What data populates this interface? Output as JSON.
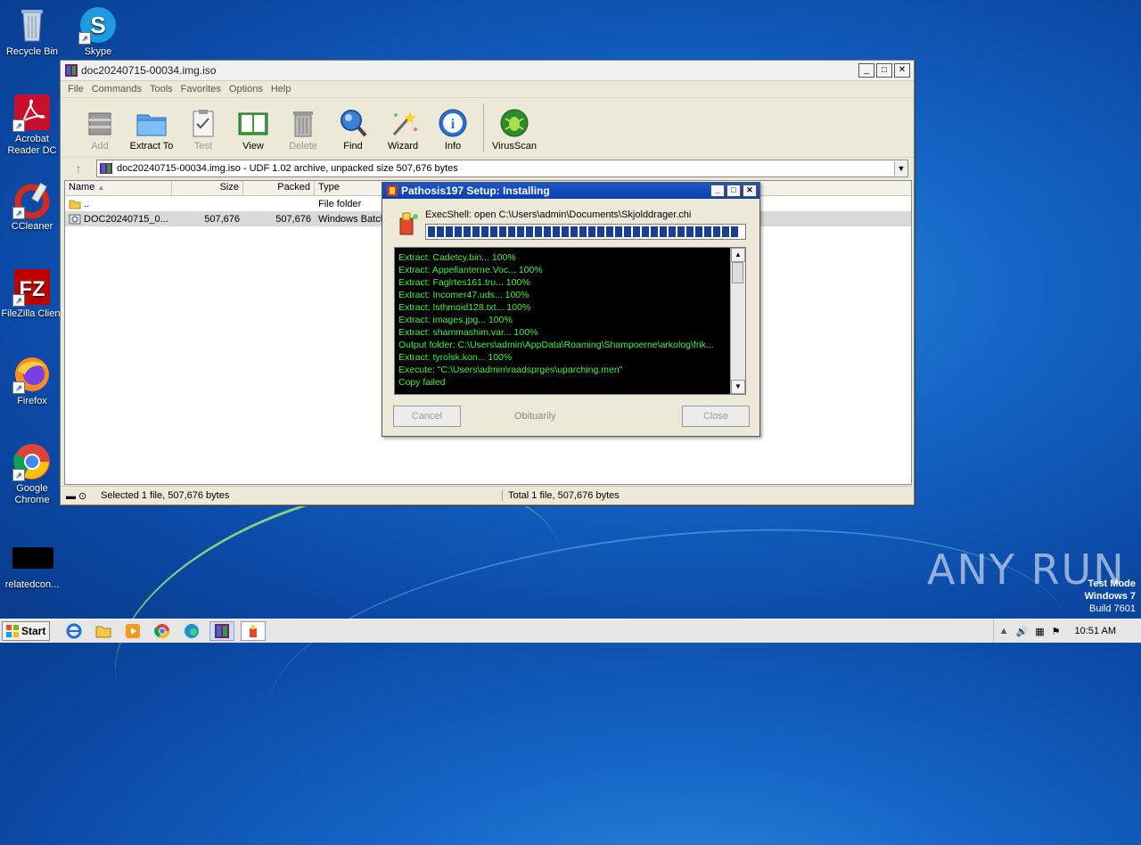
{
  "desktop": {
    "icons": [
      {
        "label": "Recycle Bin"
      },
      {
        "label": "Skype"
      },
      {
        "label": "Acrobat Reader DC"
      },
      {
        "label": "CCleaner"
      },
      {
        "label": "FileZilla Client"
      },
      {
        "label": "Firefox"
      },
      {
        "label": "Google Chrome"
      },
      {
        "label": "relatedcon..."
      }
    ]
  },
  "winrar": {
    "title": "doc20240715-00034.img.iso",
    "menu": [
      "File",
      "Commands",
      "Tools",
      "Favorites",
      "Options",
      "Help"
    ],
    "toolbar": [
      {
        "label": "Add",
        "icon": "add-archive-icon",
        "enabled": false
      },
      {
        "label": "Extract To",
        "icon": "extract-folder-icon",
        "enabled": true
      },
      {
        "label": "Test",
        "icon": "test-clipboard-icon",
        "enabled": false
      },
      {
        "label": "View",
        "icon": "view-book-icon",
        "enabled": true
      },
      {
        "label": "Delete",
        "icon": "trash-icon",
        "enabled": false
      },
      {
        "label": "Find",
        "icon": "magnifier-icon",
        "enabled": true
      },
      {
        "label": "Wizard",
        "icon": "wand-icon",
        "enabled": true
      },
      {
        "label": "Info",
        "icon": "info-icon",
        "enabled": true
      },
      {
        "label": "VirusScan",
        "icon": "virusscan-icon",
        "enabled": true
      }
    ],
    "address": "doc20240715-00034.img.iso - UDF 1.02 archive, unpacked size 507,676 bytes",
    "columns": [
      "Name",
      "Size",
      "Packed",
      "Type"
    ],
    "rows": [
      {
        "name": "..",
        "size": "",
        "packed": "",
        "type": "File folder"
      },
      {
        "name": "DOC20240715_0...",
        "size": "507,676",
        "packed": "507,676",
        "type": "Windows Batch"
      }
    ],
    "status_left": "Selected 1 file, 507,676 bytes",
    "status_right": "Total 1 file, 507,676 bytes"
  },
  "installer": {
    "title": "Pathosis197 Setup: Installing",
    "exec": "ExecShell: open C:\\Users\\admin\\Documents\\Skjolddrager.chi",
    "progress": 1.0,
    "log": [
      "Extract: Cadetcy.bin... 100%",
      "Extract: Appellanterne.Voc... 100%",
      "Extract: Faglrtes161.tru... 100%",
      "Extract: Incomer47.uds... 100%",
      "Extract: Isthmoid128.txt... 100%",
      "Extract: images.jpg... 100%",
      "Extract: shammashim.var... 100%",
      "Output folder: C:\\Users\\admin\\AppData\\Roaming\\Shampoerne\\arkolog\\frik...",
      "Extract: tyrolsk.kon... 100%",
      "Execute: \"C:\\Users\\admin\\raadsprges\\uparching.men\"",
      "Copy failed"
    ],
    "cancel": "Cancel",
    "branding": "Obituarily",
    "close": "Close"
  },
  "taskbar": {
    "start": "Start",
    "clock": "10:51 AM"
  },
  "watermark": {
    "line1": "Test Mode",
    "line2": "Windows 7",
    "line3": "Build 7601",
    "brand": "ANY RUN"
  },
  "colors": {
    "log_text": "#3ff03f",
    "progress": "#1a3f8f",
    "dialog_title": "#1a56c8"
  }
}
